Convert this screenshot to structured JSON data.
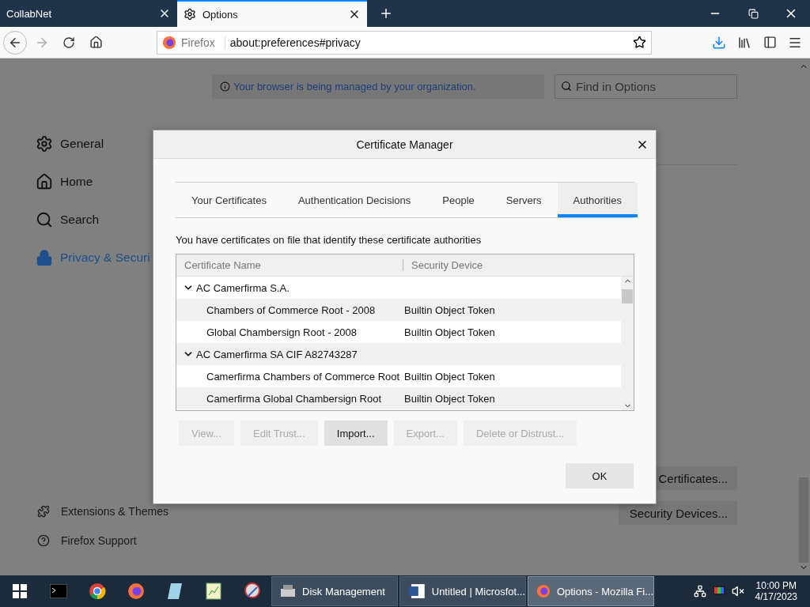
{
  "browser_tabs": [
    {
      "label": "CollabNet",
      "selected": false
    },
    {
      "label": "Options",
      "selected": true
    }
  ],
  "url_bar": {
    "identity": "Firefox",
    "url": "about:preferences#privacy"
  },
  "notice": "Your browser is being managed by your organization.",
  "find": {
    "placeholder": "Find in Options"
  },
  "sidebar": {
    "items": [
      {
        "label": "General",
        "kind": "gear",
        "selected": false
      },
      {
        "label": "Home",
        "kind": "home",
        "selected": false
      },
      {
        "label": "Search",
        "kind": "search",
        "selected": false
      },
      {
        "label": "Privacy & Securi",
        "kind": "lock",
        "selected": true
      }
    ],
    "footer": [
      {
        "label": "Extensions & Themes",
        "kind": "puzzle"
      },
      {
        "label": "Firefox Support",
        "kind": "help"
      }
    ]
  },
  "page_buttons": [
    "Certificates...",
    "Security Devices..."
  ],
  "dialog": {
    "title": "Certificate Manager",
    "tabs": [
      {
        "label": "Your Certificates",
        "selected": false
      },
      {
        "label": "Authentication Decisions",
        "selected": false
      },
      {
        "label": "People",
        "selected": false
      },
      {
        "label": "Servers",
        "selected": false
      },
      {
        "label": "Authorities",
        "selected": true
      }
    ],
    "description": "You have certificates on file that identify these certificate authorities",
    "columns": [
      "Certificate Name",
      "Security Device"
    ],
    "tree": [
      {
        "name": "AC Camerfirma S.A.",
        "expanded": true,
        "children": [
          {
            "name": "Chambers of Commerce Root - 2008",
            "device": "Builtin Object Token"
          },
          {
            "name": "Global Chambersign Root - 2008",
            "device": "Builtin Object Token"
          }
        ]
      },
      {
        "name": "AC Camerfirma SA CIF A82743287",
        "expanded": true,
        "children": [
          {
            "name": "Camerfirma Chambers of Commerce Root",
            "device": "Builtin Object Token"
          },
          {
            "name": "Camerfirma Global Chambersign Root",
            "device": "Builtin Object Token"
          }
        ]
      }
    ],
    "buttons": [
      {
        "label": "View...",
        "disabled": true
      },
      {
        "label": "Edit Trust...",
        "disabled": true
      },
      {
        "label": "Import...",
        "disabled": false
      },
      {
        "label": "Export...",
        "disabled": true
      },
      {
        "label": "Delete or Distrust...",
        "disabled": true
      }
    ],
    "ok": "OK"
  },
  "taskbar": {
    "tasks": [
      {
        "label": "Disk Management",
        "kind": "disk",
        "selected": false
      },
      {
        "label": "Untitled | Microsfot...",
        "kind": "word",
        "selected": false
      },
      {
        "label": "Options - Mozilla Fi...",
        "kind": "firefox",
        "selected": true
      }
    ],
    "time": "10:00 PM",
    "date": "4/17/2023"
  }
}
